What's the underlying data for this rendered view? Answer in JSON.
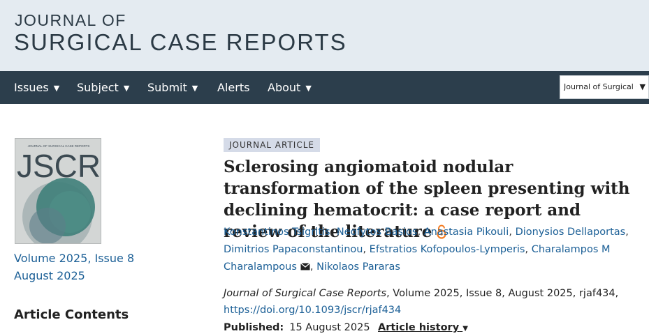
{
  "header": {
    "logo_line1": "JOURNAL OF",
    "logo_line2": "SURGICAL CASE REPORTS"
  },
  "nav": {
    "items": [
      {
        "label": "Issues",
        "has_dropdown": true
      },
      {
        "label": "Subject",
        "has_dropdown": true
      },
      {
        "label": "Submit",
        "has_dropdown": true
      },
      {
        "label": "Alerts",
        "has_dropdown": false
      },
      {
        "label": "About",
        "has_dropdown": true
      }
    ],
    "journal_select": "Journal of Surgical Case Reports"
  },
  "sidebar": {
    "cover_title": "JSCR",
    "cover_small_heading": "JOURNAL OF SURGICAL CASE REPORTS",
    "issue_link": "Volume 2025, Issue 8",
    "date_link": "August 2025",
    "contents_heading": "Article Contents"
  },
  "article": {
    "type_badge": "JOURNAL ARTICLE",
    "title": "Sclerosing angiomatoid nodular transformation of the spleen presenting with declining hematocrit: a case report and review of the literature",
    "authors": [
      "Konstantinos Tsigritis",
      "Neofytos Basios",
      "Anastasia Pikouli",
      "Dionysios Dellaportas",
      "Dimitrios Papaconstantinou",
      "Efstratios Kofopoulos-Lymperis",
      "Charalampos M Charalampous",
      "Nikolaos Pararas"
    ],
    "citation_journal": "Journal of Surgical Case Reports",
    "citation_rest": ", Volume 2025, Issue 8, August 2025, rjaf434, ",
    "doi": "https://doi.org/10.1093/jscr/rjaf434",
    "published_label": "Published:",
    "published_date": "15 August 2025",
    "history_label": "Article history"
  },
  "colors": {
    "nav_bg": "#2c3e4c",
    "header_bg": "#e4ebf1",
    "link": "#1b5f96",
    "badge_bg": "#d5dbe8",
    "open_access": "#f47b20"
  },
  "icons": {
    "open_access": "open-access-lock-icon",
    "corresponding": "envelope-icon",
    "dropdown": "caret-down-icon"
  }
}
